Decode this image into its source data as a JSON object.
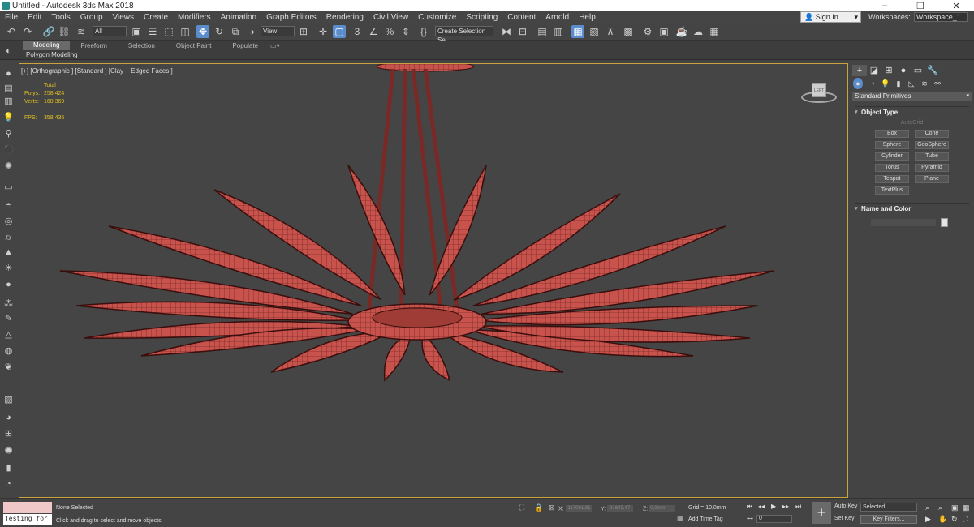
{
  "window": {
    "title": "Untitled - Autodesk 3ds Max 2018",
    "minimize": "–",
    "maximize": "❐",
    "close": "✕"
  },
  "menu": [
    "File",
    "Edit",
    "Tools",
    "Group",
    "Views",
    "Create",
    "Modifiers",
    "Animation",
    "Graph Editors",
    "Rendering",
    "Civil View",
    "Customize",
    "Scripting",
    "Content",
    "Arnold",
    "Help"
  ],
  "account": {
    "sign_in": "Sign In",
    "workspaces_label": "Workspaces:",
    "workspace": "Workspace_1"
  },
  "toolbar": {
    "filter_all": "All",
    "ref_coord": "View",
    "create_selection_set": "Create Selection Se"
  },
  "ribbon": {
    "tabs": [
      "Modeling",
      "Freeform",
      "Selection",
      "Object Paint",
      "Populate"
    ],
    "active_tab": "Modeling",
    "sub": "Polygon Modeling"
  },
  "viewport": {
    "label": "[+] [Orthographic ] [Standard ] [Clay + Edged Faces ]",
    "stats": {
      "total_label": "Total",
      "polys_label": "Polys:",
      "polys": "258 424",
      "verts_label": "Verts:",
      "verts": "168 369",
      "fps_label": "FPS:",
      "fps": "358,436"
    },
    "viewcube_label": "LEFT",
    "model_color": "#c8534d"
  },
  "command_panel": {
    "category": "Standard Primitives",
    "object_type_title": "Object Type",
    "autogrid": "AutoGrid",
    "primitives": [
      "Box",
      "Cone",
      "Sphere",
      "GeoSphere",
      "Cylinder",
      "Tube",
      "Torus",
      "Pyramid",
      "Teapot",
      "Plane",
      "TextPlus"
    ],
    "name_and_color_title": "Name and Color"
  },
  "status": {
    "maxscript": "Testing for :",
    "selection": "None Selected",
    "prompt": "Click and drag to select and move objects",
    "x_label": "X:",
    "x": "-117061,81",
    "y_label": "Y:",
    "y": "-21643,47",
    "z_label": "Z:",
    "z": "0,0mm",
    "grid": "Grid = 10,0mm",
    "add_time_tag": "Add Time Tag",
    "frame": "0",
    "auto_key": "Auto Key",
    "set_key": "Set Key",
    "key_mode": "Selected",
    "key_filters": "Key Filters..."
  }
}
